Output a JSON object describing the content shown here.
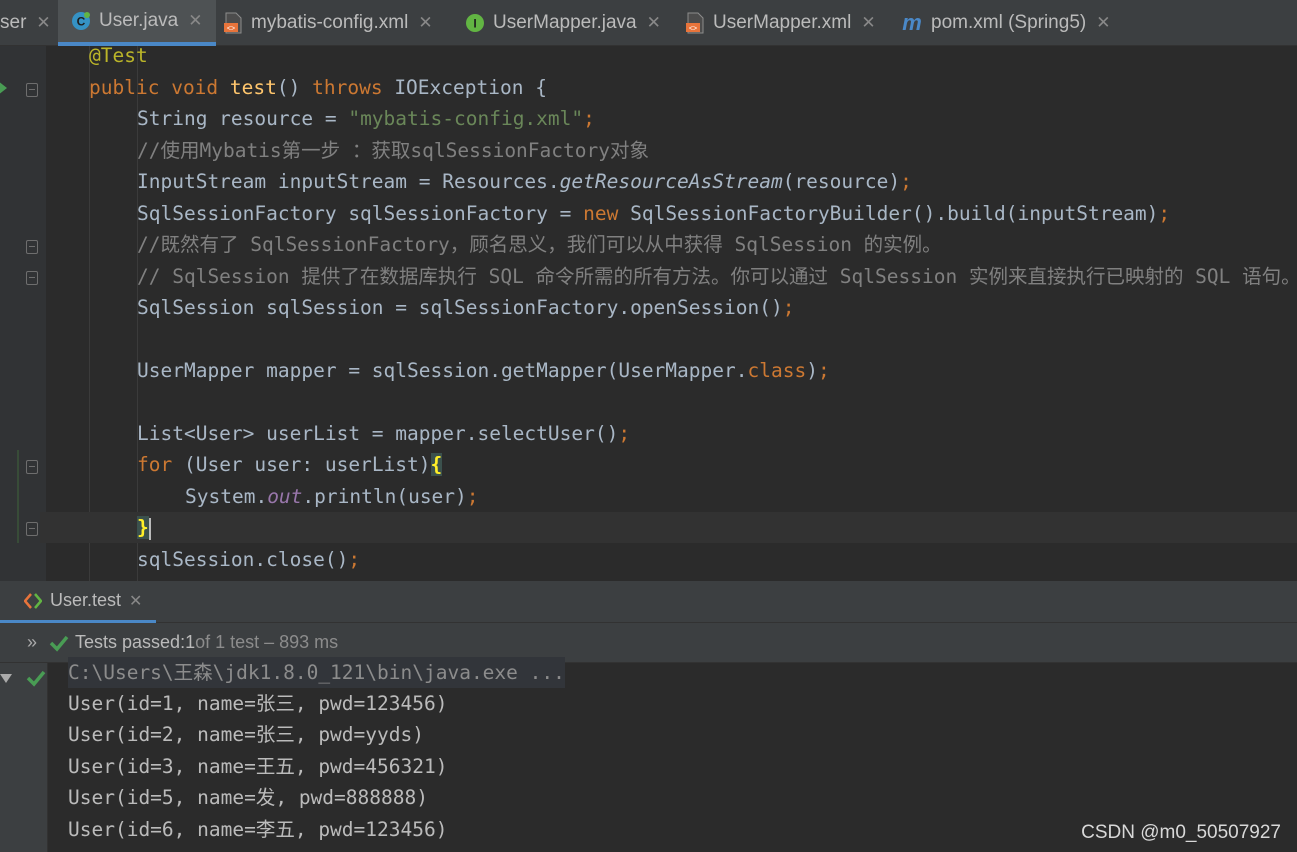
{
  "tabs": [
    {
      "label": "ser",
      "icon": "",
      "active": false
    },
    {
      "label": "User.java",
      "icon": "java-class-icon",
      "active": true
    },
    {
      "label": "mybatis-config.xml",
      "icon": "xml-file-icon",
      "active": false
    },
    {
      "label": "UserMapper.java",
      "icon": "java-interface-icon",
      "active": false
    },
    {
      "label": "UserMapper.xml",
      "icon": "xml-file-icon",
      "active": false
    },
    {
      "label": "pom.xml (Spring5)",
      "icon": "maven-icon",
      "active": false
    }
  ],
  "code": {
    "l1": {
      "annotation": "@Test"
    },
    "l2": {
      "kw_public": "public",
      "kw_void": "void",
      "method": "test",
      "parens": "() ",
      "kw_throws": "throws",
      "rest": " IOException {"
    },
    "l3": {
      "pre": "String resource = ",
      "str": "\"mybatis-config.xml\"",
      "semi": ";"
    },
    "l4": {
      "comment": "//使用Mybatis第一步 ：获取sqlSessionFactory对象"
    },
    "l5": {
      "pre": "InputStream inputStream = Resources.",
      "method": "getResourceAsStream",
      "post": "(resource)",
      "semi": ";"
    },
    "l6": {
      "pre": "SqlSessionFactory sqlSessionFactory = ",
      "kw_new": "new",
      "post": " SqlSessionFactoryBuilder().build(inputStream)",
      "semi": ";"
    },
    "l7": {
      "comment": "//既然有了 SqlSessionFactory，顾名思义，我们可以从中获得 SqlSession 的实例。"
    },
    "l8": {
      "comment": "// SqlSession 提供了在数据库执行 SQL 命令所需的所有方法。你可以通过 SqlSession 实例来直接执行已映射的 SQL 语句。"
    },
    "l9": {
      "pre": "SqlSession sqlSession = sqlSessionFactory.openSession()",
      "semi": ";"
    },
    "l10": {
      "pre": "UserMapper mapper = sqlSession.getMapper(UserMapper.",
      "kw_class": "class",
      "post": ")",
      "semi": ";"
    },
    "l11": {
      "pre": "List<User> userList = mapper.selectUser()",
      "semi": ";"
    },
    "l12": {
      "kw_for": "for",
      "mid": " (User user: userList)",
      "brace": "{"
    },
    "l13": {
      "pre": "System.",
      "field": "out",
      "post": ".println(user)",
      "semi": ";"
    },
    "l14": {
      "brace": "}"
    },
    "l15": {
      "pre": "sqlSession.close()",
      "semi": ";"
    }
  },
  "run": {
    "tab_label": "User.test",
    "status_prefix": "Tests passed: ",
    "status_count": "1",
    "status_suffix": " of 1 test – 893 ms",
    "console": [
      "C:\\Users\\王森\\jdk1.8.0_121\\bin\\java.exe ...",
      "User(id=1, name=张三, pwd=123456)",
      "User(id=2, name=张三, pwd=yyds)",
      "User(id=3, name=王五, pwd=456321)",
      "User(id=5, name=发, pwd=888888)",
      "User(id=6, name=李五, pwd=123456)"
    ]
  },
  "watermark": "CSDN @m0_50507927",
  "colors": {
    "background": "#2b2b2b",
    "keyword": "#cc7832",
    "string": "#6a8759",
    "comment": "#808080",
    "annotation": "#bbb529",
    "method_decl": "#ffc66d",
    "static_field": "#9876aa",
    "pass_green": "#499c54",
    "tab_accent": "#4a88c7"
  }
}
